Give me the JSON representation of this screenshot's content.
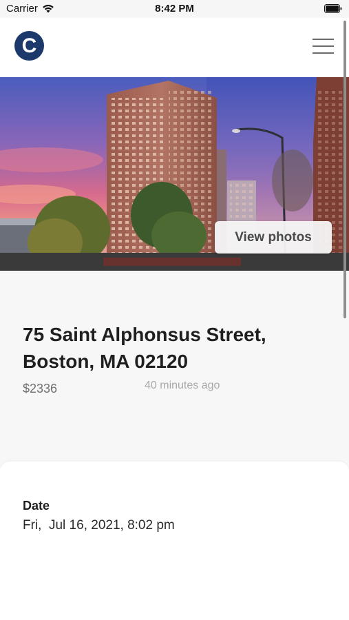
{
  "status_bar": {
    "carrier": "Carrier",
    "time": "8:42 PM"
  },
  "header": {
    "logo_letter": "C",
    "logo_color": "#1b3a6b",
    "menu_icon": "hamburger-menu-icon"
  },
  "hero": {
    "view_photos_label": "View photos"
  },
  "listing": {
    "address_line1": "75 Saint Alphonsus Street,",
    "address_line2": "Boston, MA 02120",
    "price": "$2336",
    "posted_ago": "40 minutes ago"
  },
  "details": {
    "date_label": "Date",
    "date_value": "Fri,  Jul 16, 2021, 8:02 pm"
  }
}
